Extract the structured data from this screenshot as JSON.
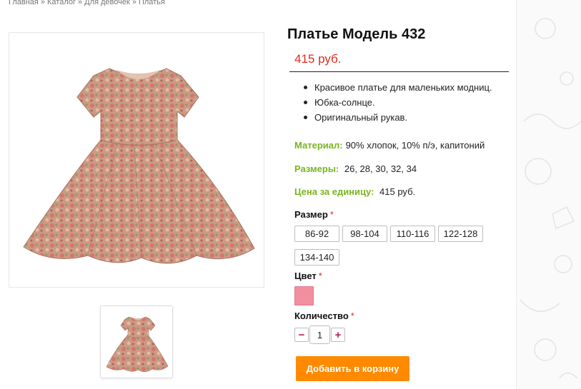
{
  "breadcrumb": {
    "items": [
      "Главная",
      "Каталог",
      "Для девочек",
      "Платья"
    ],
    "separator": "»"
  },
  "product": {
    "title": "Платье Модель 432",
    "price": "415 руб.",
    "features": [
      "Красивое платье для маленьких модниц.",
      "Юбка-солнце.",
      "Оригинальный рукав."
    ],
    "properties": {
      "material_label": "Материал:",
      "material_value": "90% хлопок, 10% п/э, капитоний",
      "sizes_label": "Размеры:",
      "sizes_value": "26, 28, 30, 32, 34",
      "unit_price_label": "Цена за единицу:",
      "unit_price_value": "415 руб."
    },
    "images": {
      "main_alt": "dress-photo",
      "thumb_alt": "dress-thumbnail"
    }
  },
  "options": {
    "size_label": "Размер",
    "size_options": [
      "86-92",
      "98-104",
      "110-116",
      "122-128",
      "134-140"
    ],
    "color_label": "Цвет",
    "color_swatch": "#f38da0",
    "quantity_label": "Количество",
    "quantity_value": "1",
    "required_mark": "*"
  },
  "actions": {
    "minus": "−",
    "plus": "+",
    "add_to_cart": "Добавить в корзину"
  },
  "colors": {
    "accent_orange": "#ff8a00",
    "price_red": "#e02b20",
    "label_green": "#7ab51d"
  }
}
